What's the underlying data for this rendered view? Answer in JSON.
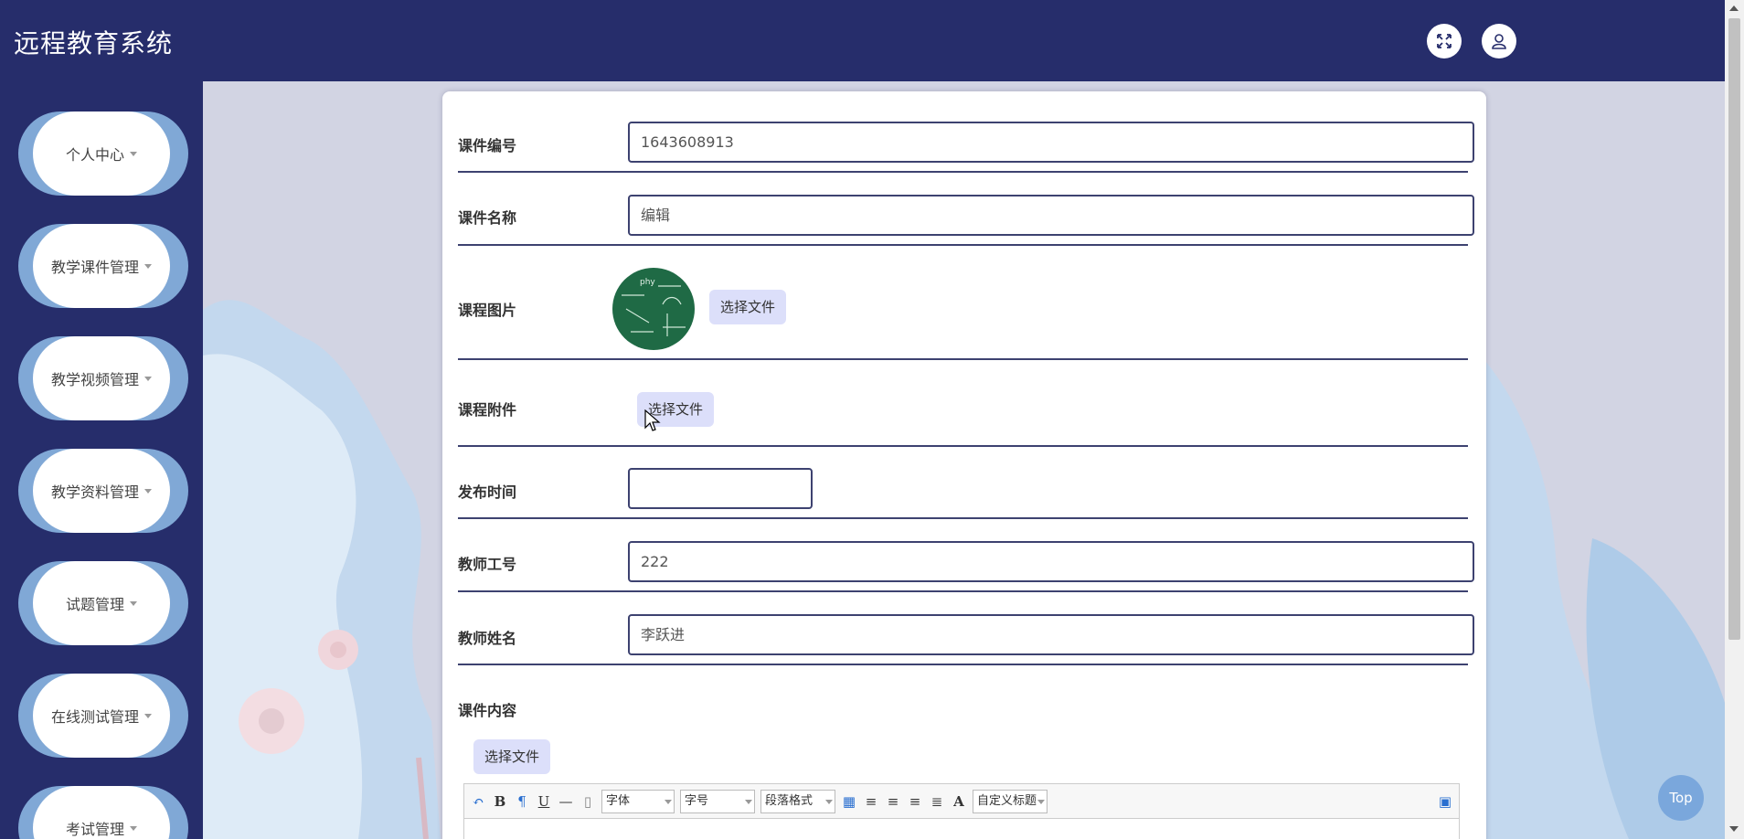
{
  "app": {
    "title": "远程教育系统"
  },
  "header": {
    "fullscreen_icon": "fullscreen-icon",
    "user_icon": "user-icon"
  },
  "sidebar": {
    "items": [
      {
        "label": "个人中心"
      },
      {
        "label": "教学课件管理"
      },
      {
        "label": "教学视频管理"
      },
      {
        "label": "教学资料管理"
      },
      {
        "label": "试题管理"
      },
      {
        "label": "在线测试管理"
      },
      {
        "label": "考试管理"
      }
    ]
  },
  "form": {
    "course_no": {
      "label": "课件编号",
      "value": "1643608913"
    },
    "course_name": {
      "label": "课件名称",
      "value": "编辑"
    },
    "course_image": {
      "label": "课程图片",
      "button": "选择文件"
    },
    "course_attachment": {
      "label": "课程附件",
      "button": "选择文件"
    },
    "publish_time": {
      "label": "发布时间",
      "value": ""
    },
    "teacher_id": {
      "label": "教师工号",
      "value": "222"
    },
    "teacher_name": {
      "label": "教师姓名",
      "value": "李跃进"
    },
    "content": {
      "label": "课件内容",
      "button": "选择文件"
    }
  },
  "editor": {
    "font_family": "字体",
    "font_size": "字号",
    "paragraph": "段落格式",
    "custom_title": "自定义标题",
    "text_color_glyph": "A"
  },
  "back_to_top": "Top",
  "colors": {
    "header": "#262d6b",
    "accent": "#80a8d6",
    "file_button": "#dcdffa"
  }
}
